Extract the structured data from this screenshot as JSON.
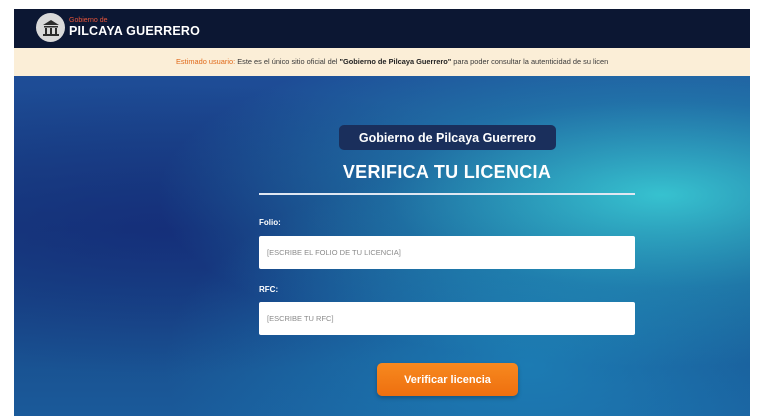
{
  "header": {
    "brand_small": "Gobierno de",
    "brand_main": "PILCAYA GUERRERO",
    "logo_icon": "government-building-icon"
  },
  "notice": {
    "lead": "Estimado usuario:",
    "text_before": " Este es el único sitio oficial del ",
    "quoted": "\"Gobierno de Pilcaya Guerrero\"",
    "text_after": " para poder consultar la autenticidad de su licen"
  },
  "form": {
    "government_label": "Gobierno de Pilcaya Guerrero",
    "title": "VERIFICA TU LICENCIA",
    "folio_label": "Folio:",
    "folio_placeholder": "[ESCRIBE EL FOLIO DE TU LICENCIA]",
    "rfc_label": "RFC:",
    "rfc_placeholder": "[ESCRIBE TU RFC]",
    "submit_label": "Verificar licencia"
  },
  "colors": {
    "topbar": "#0c1733",
    "notice_bg": "#fbeed7",
    "accent_orange": "#f7891f",
    "pill_bg": "#1a2f5c"
  }
}
